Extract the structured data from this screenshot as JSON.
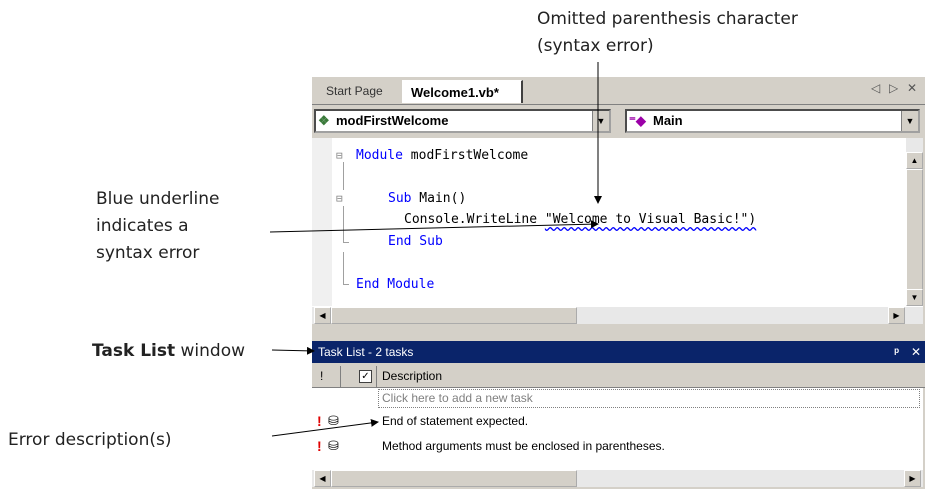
{
  "annotations": {
    "omitted_line1": "Omitted parenthesis character",
    "omitted_line2": "(syntax error)",
    "blue_line1": "Blue underline",
    "blue_line2": "indicates a",
    "blue_line3": "syntax error",
    "tasklist_bold": "Task List",
    "tasklist_rest": " window",
    "error_desc": "Error description(s)"
  },
  "tabs": [
    {
      "label": "Start Page",
      "active": false
    },
    {
      "label": "Welcome1.vb*",
      "active": true
    }
  ],
  "tab_controls": {
    "left": "◁",
    "right": "▷",
    "close": "✕"
  },
  "combo_left": {
    "icon": "module-icon",
    "value": "modFirstWelcome"
  },
  "combo_right": {
    "icon": "method-icon",
    "value": "Main"
  },
  "code": {
    "line1_kw": "Module",
    "line1_rest": " modFirstWelcome",
    "line2_kw": "Sub",
    "line2_rest": " Main()",
    "line3_pre": "Console.WriteLine ",
    "line3_err": "\"Welcome to Visual Basic!\")",
    "line4": "End Sub",
    "line5": "End Module"
  },
  "task_list": {
    "title": "Task List - 2 tasks",
    "pin": "ᵖ",
    "close": "✕",
    "col_priority": "!",
    "col_description": "Description",
    "placeholder": "Click here to add a new task",
    "tasks": [
      {
        "priority": "!",
        "description": "End of statement expected."
      },
      {
        "priority": "!",
        "description": "Method arguments must be enclosed in parentheses."
      }
    ]
  },
  "colors": {
    "keyword": "#0000ff",
    "titlebar": "#0a246a",
    "error_marker": "#e00000"
  }
}
